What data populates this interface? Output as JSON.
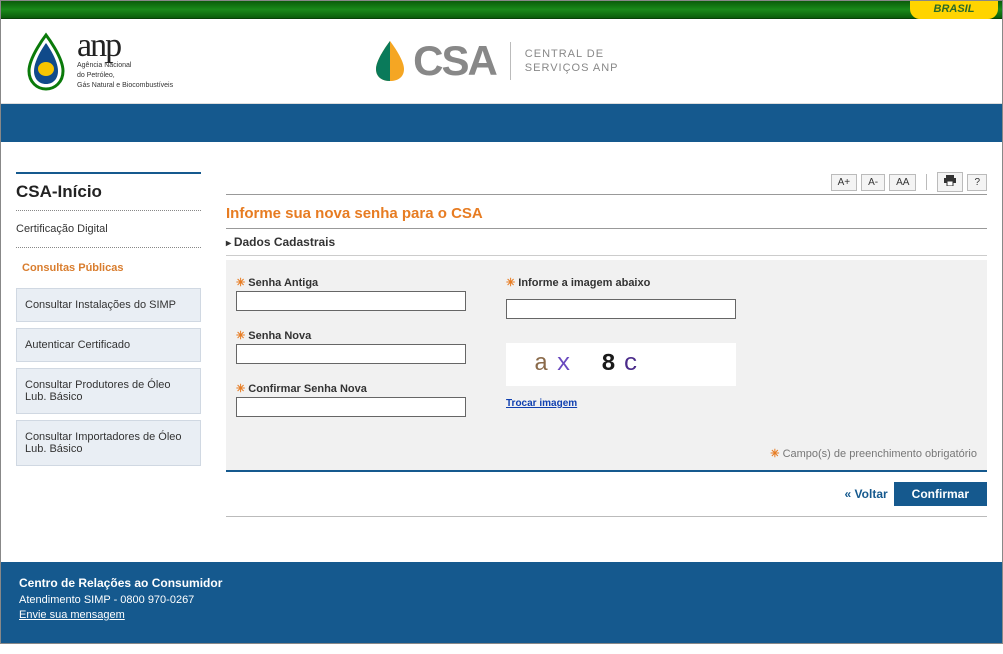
{
  "topbar": {
    "brasil": "BRASIL"
  },
  "header": {
    "anp_name": "anp",
    "anp_sub1": "Agência Nacional",
    "anp_sub2": "do Petróleo,",
    "anp_sub3": "Gás Natural e Biocombustíveis",
    "csa_name": "CSA",
    "csa_desc1": "CENTRAL DE",
    "csa_desc2": "SERVIÇOS ANP"
  },
  "toolbar": {
    "font_inc": "A+",
    "font_dec": "A-",
    "font_reset": "AA",
    "print": "🖶",
    "help": "?"
  },
  "sidebar": {
    "title": "CSA-Início",
    "cert": "Certificação Digital",
    "section": "Consultas Públicas",
    "items": [
      "Consultar Instalações do SIMP",
      "Autenticar Certificado",
      "Consultar Produtores de Óleo Lub. Básico",
      "Consultar Importadores de Óleo Lub. Básico"
    ]
  },
  "page": {
    "title": "Informe sua nova senha para o CSA",
    "subsection": "Dados Cadastrais",
    "labels": {
      "old_pw": "Senha Antiga",
      "new_pw": "Senha Nova",
      "confirm_pw": "Confirmar Senha Nova",
      "captcha": "Informe a imagem abaixo"
    },
    "captcha_value": "ax8c",
    "change_image": "Trocar imagem",
    "required_note": "Campo(s) de preenchimento obrigatório",
    "back": "« Voltar",
    "confirm": "Confirmar"
  },
  "footer": {
    "title": "Centro de Relações ao Consumidor",
    "phone": "Atendimento SIMP - 0800 970-0267",
    "link": "Envie sua mensagem"
  }
}
